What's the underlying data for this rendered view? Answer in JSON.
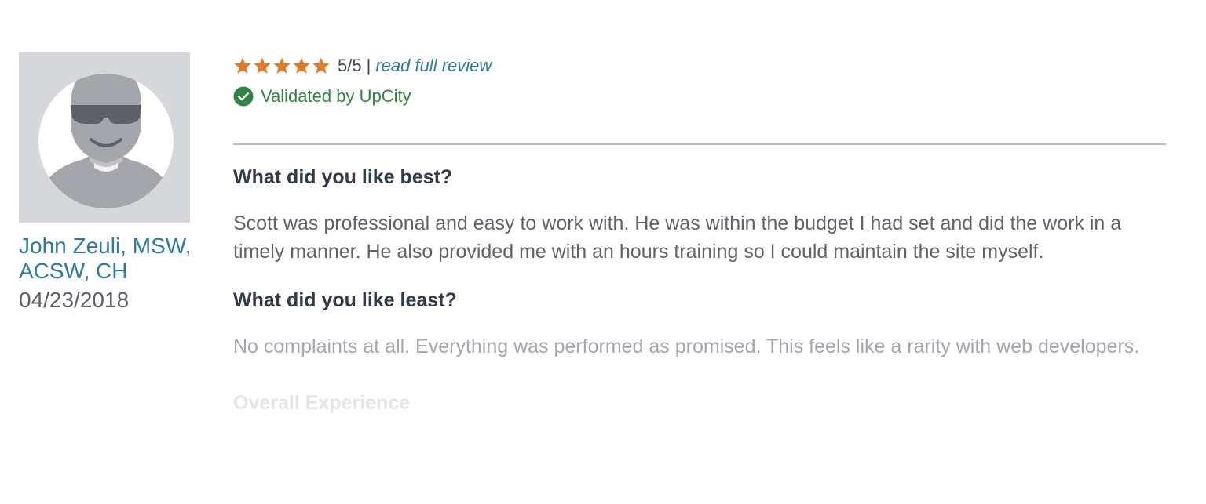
{
  "reviewer": {
    "name": "John Zeuli, MSW, ACSW, CH",
    "date": "04/23/2018",
    "avatar_icon": "person-silhouette-sunglasses-icon"
  },
  "rating": {
    "stars_filled": 5,
    "stars_total": 5,
    "score_text": "5/5",
    "separator": "|",
    "read_full_review_label": "read full review",
    "star_color": "#e07b2a"
  },
  "validation": {
    "text": "Validated by UpCity",
    "icon": "check-circle-icon",
    "color": "#2e8540"
  },
  "sections": [
    {
      "question": "What did you like best?",
      "answer": "Scott was professional and easy to work with. He was within the budget I had set and did the work in a timely manner. He also provided me with an hours training so I could maintain the site myself."
    },
    {
      "question": "What did you like least?",
      "answer": "No complaints at all. Everything was performed as promised. This feels like a rarity with web developers."
    },
    {
      "question": "Overall Experience"
    }
  ],
  "colors": {
    "link": "#2d7aa0",
    "heading": "#333a48",
    "body": "#5f646c"
  }
}
